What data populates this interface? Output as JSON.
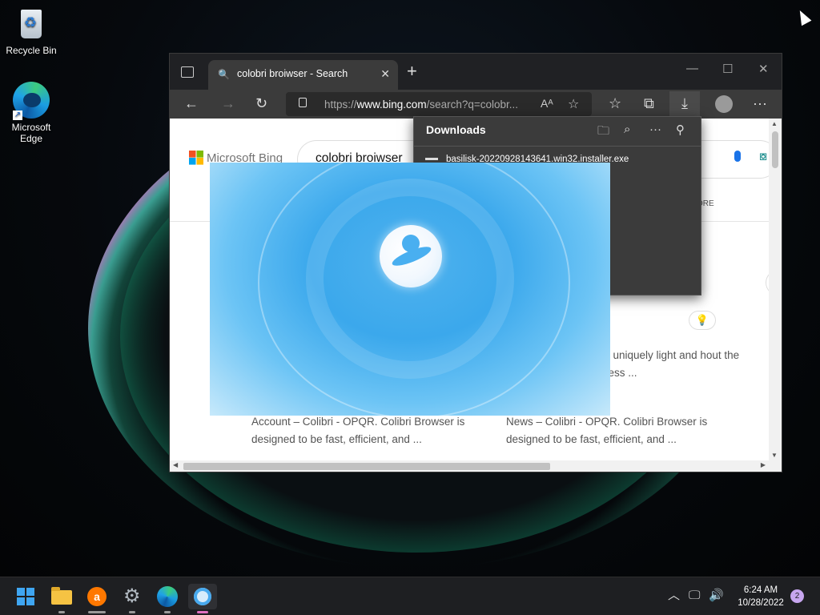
{
  "desktop": {
    "icons": [
      {
        "label": "Recycle Bin"
      },
      {
        "label": "Microsoft Edge"
      }
    ]
  },
  "browser": {
    "tab_title": "colobri broiwser - Search",
    "tab_close": "✕",
    "new_tab": "+",
    "window_controls": {
      "minimize": "—",
      "maximize": "☐",
      "close": "✕"
    },
    "address": {
      "url_prefix": "https://",
      "url_domain": "www.bing.com",
      "url_rest": "/search?q=colobr..."
    },
    "nav": {
      "back": "←",
      "forward": "→",
      "refresh": "↻",
      "read_aloud": "Aᴬ",
      "add_favorite": "☆",
      "favorites": "☆",
      "collections": "⧉",
      "downloads": "⤓",
      "menu": "···"
    },
    "page": {
      "logo_text": "Microsoft Bing",
      "query": "colobri broiwser",
      "more_tab": "ORE",
      "snippet1": "ce is uniquely light and hout the endless ...",
      "snippet2": "Account – Colibri - OPQR. Colibri Browser is designed to be fast, efficient, and ...",
      "snippet3": "News – Colibri - OPQR. Colibri Browser is designed to be fast, efficient, and ..."
    },
    "downloads": {
      "title": "Downloads",
      "file_name": "basilisk-20220928143641.win32.installer.exe"
    }
  },
  "taskbar": {
    "time": "6:24 AM",
    "date": "10/28/2022",
    "notifications": "2",
    "tray": {
      "chevron": "︿",
      "network": "🖵",
      "volume": "🔊"
    }
  }
}
